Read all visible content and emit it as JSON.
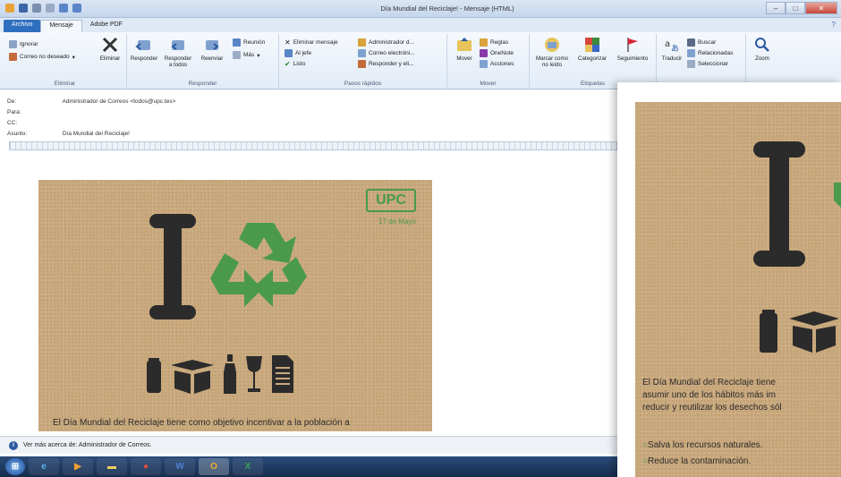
{
  "window": {
    "title": "Día Mundial del Reciclaje! - Mensaje (HTML)"
  },
  "tabs": [
    {
      "label": "Archivo"
    },
    {
      "label": "Mensaje"
    },
    {
      "label": "Adobe PDF"
    }
  ],
  "ribbon": {
    "eliminar": {
      "ignorar": "Ignorar",
      "correo_no_deseado": "Correo no deseado",
      "eliminar": "Eliminar",
      "label": "Eliminar"
    },
    "responder": {
      "responder": "Responder",
      "responder_todos_1": "Responder",
      "responder_todos_2": "a todos",
      "reenviar": "Reenviar",
      "reunion": "Reunión",
      "mas": "Más",
      "label": "Responder"
    },
    "pasos": {
      "eliminar_mensaje": "Eliminar mensaje",
      "al_jefe": "Al jefe",
      "listo": "Listo",
      "administrador": "Administrador d...",
      "correo_electronico": "Correo electróni...",
      "responder_y_eli": "Responder y eli...",
      "label": "Pasos rápidos"
    },
    "mover": {
      "mover": "Mover",
      "reglas": "Reglas",
      "onenote": "OneNote",
      "acciones": "Acciones",
      "label": "Mover"
    },
    "etiquetas": {
      "marcar_1": "Marcar como",
      "marcar_2": "no leído",
      "categorizar": "Categorizar",
      "seguimiento": "Seguimiento",
      "label": "Etiquetas"
    },
    "edicion": {
      "traducir": "Traducir",
      "buscar": "Buscar",
      "relacionadas": "Relacionadas",
      "seleccionar": "Seleccionar"
    },
    "zoom": {
      "zoom": "Zoom"
    }
  },
  "header": {
    "de_label": "De:",
    "de_value": "Administrador de Correos <todos@upc.tes>",
    "para_label": "Para:",
    "cc_label": "CC:",
    "asunto_label": "Asunto:",
    "asunto_value": "Día Mundial del Reciclaje!"
  },
  "card": {
    "badge": "UPC",
    "date": "17 de Mayo",
    "big_letter": "I",
    "body_line": "El Día Mundial del Reciclaje tiene como objetivo incentivar a la población a"
  },
  "overlay": {
    "line1": "El Día Mundial del Reciclaje tiene",
    "line2": "asumir uno de los hábitos más im",
    "line3": "reducir y reutilizar los desechos sól",
    "bullet1": "Salva los recursos naturales.",
    "bullet2": "Reduce la contaminación.",
    "big_letter": "I"
  },
  "infobar": {
    "text": "Ver más acerca de: Administrador de Correos."
  },
  "colors": {
    "accent_green": "#4a9a4a",
    "kraft": "#c9a97e",
    "ink": "#2b2b2b",
    "file_tab": "#2f6fbf"
  }
}
